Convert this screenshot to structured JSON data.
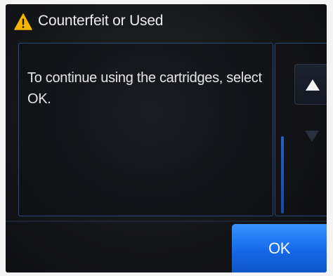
{
  "dialog": {
    "title": "Counterfeit or Used",
    "title_icon": "warning-triangle-icon",
    "message": "To continue using the cartridges, select OK.",
    "ok_label": "OK"
  },
  "controls": {
    "scroll_up_icon": "up-triangle-icon",
    "scroll_down_icon": "down-triangle-icon"
  },
  "colors": {
    "accent_blue": "#1a6cf0",
    "warning_yellow": "#f4b400",
    "background": "#141518",
    "text": "#e6e6e6"
  }
}
